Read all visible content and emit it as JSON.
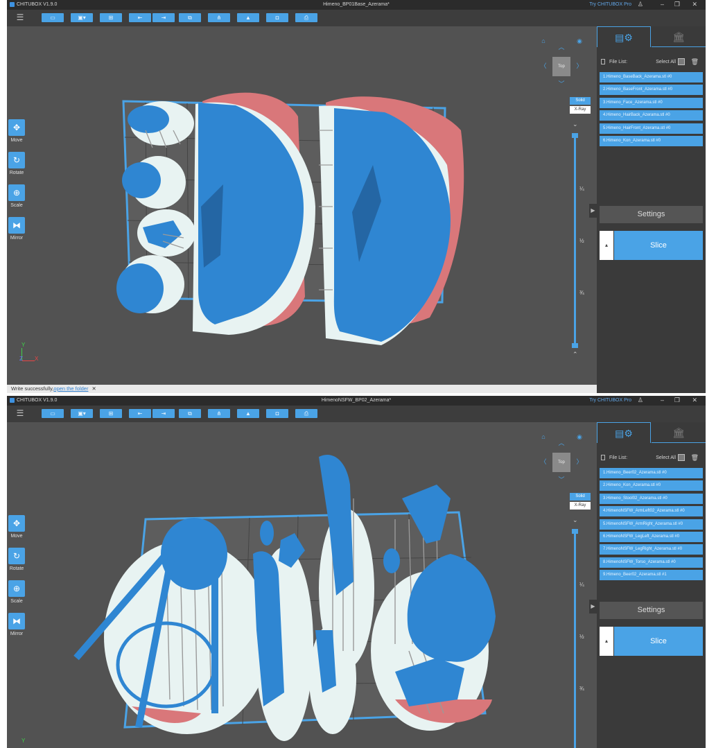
{
  "app": {
    "name": "CHITUBOX V1.9.0",
    "try_pro": "Try CHITUBOX Pro"
  },
  "common": {
    "file_list_label": "File List:",
    "select_all": "Select All",
    "settings": "Settings",
    "slice": "Slice",
    "view_mode": {
      "solid": "Solid",
      "xray": "X-Ray"
    },
    "top_view": "Top",
    "tools": [
      "Move",
      "Rotate",
      "Scale",
      "Mirror"
    ],
    "slider_ticks": [
      "¼",
      "½",
      "¾"
    ],
    "axes": {
      "y": "Y",
      "z": "Z",
      "x": "X"
    },
    "window_controls": {
      "user": "♙",
      "minimize": "–",
      "restore": "❐",
      "close": "✕"
    }
  },
  "windows": [
    {
      "doc_title": "Himeno_BP01Base_Azerama*",
      "files": [
        "1.Himeno_BaseBack_Azerama.stl #0",
        "2.Himeno_BaseFront_Azerama.stl #0",
        "3.Himeno_Face_Azerama.stl #0",
        "4.Himeno_HairBack_Azerama.stl #0",
        "5.Himeno_HairFront_Azerama.stl #0",
        "6.Himeno_Kon_Azerama.stl #0"
      ],
      "status": {
        "text": "Write successfully,",
        "link": "open the folder",
        "close": "✕"
      }
    },
    {
      "doc_title": "HimenoNSFW_BP02_Azerama*",
      "files": [
        "1.Himeno_Beer02_Azerama.stl #0",
        "2.Himeno_Kon_Azerama.stl #0",
        "3.Himeno_Stool02_Azerama.stl #0",
        "4.HimenoNSFW_ArmLeft02_Azerama.stl #0",
        "5.HimenoNSFW_ArmRight_Azerama.stl #0",
        "6.HimenoNSFW_LegLeft_Azerama.stl #0",
        "7.HimenoNSFW_LegRight_Azerama.stl #0",
        "8.HimenoNSFW_Torso_Azerama.stl #0",
        "9.Himeno_Beer02_Azerama.stl #1"
      ]
    }
  ],
  "colors": {
    "accent": "#4aa3e6",
    "model": "#2f86d2",
    "raft": "#e8f3f2",
    "overhang": "#d9777a",
    "plate": "#5e5e5e",
    "titlebar": "#2b2b2b"
  }
}
